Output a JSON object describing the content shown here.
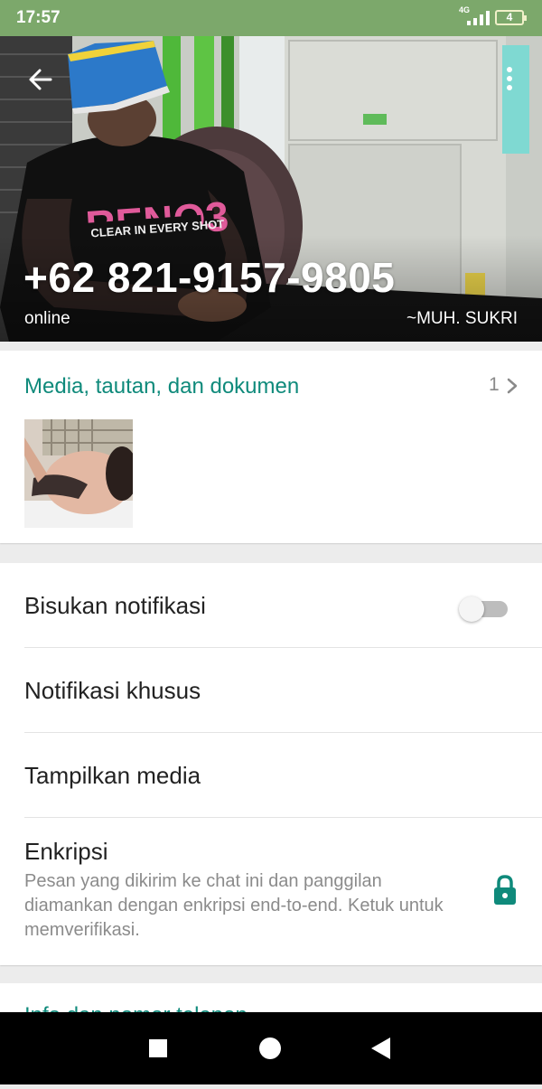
{
  "status_bar": {
    "time": "17:57",
    "network": "4G",
    "battery": "4"
  },
  "header": {
    "phone_number": "+62 821-9157-9805",
    "status": "online",
    "push_name": "~MUH. SUKRI",
    "back_icon": "arrow-left-icon",
    "menu_icon": "more-vert-icon"
  },
  "media": {
    "title": "Media, tautan, dan dokumen",
    "count": "1"
  },
  "settings": {
    "mute_label": "Bisukan notifikasi",
    "mute_enabled": false,
    "custom_notifications_label": "Notifikasi khusus",
    "media_visibility_label": "Tampilkan media",
    "encryption_label": "Enkripsi",
    "encryption_description": "Pesan yang dikirim ke chat ini dan panggilan diamankan dengan enkripsi end-to-end. Ketuk untuk memverifikasi."
  },
  "next_section": {
    "label": "Info dan nomor telepon"
  },
  "colors": {
    "status_bar": "#7ca86b",
    "accent": "#0f8a7b",
    "background": "#ececec"
  },
  "nav": {
    "recents_icon": "square-icon",
    "home_icon": "circle-icon",
    "back_icon": "triangle-back-icon"
  }
}
